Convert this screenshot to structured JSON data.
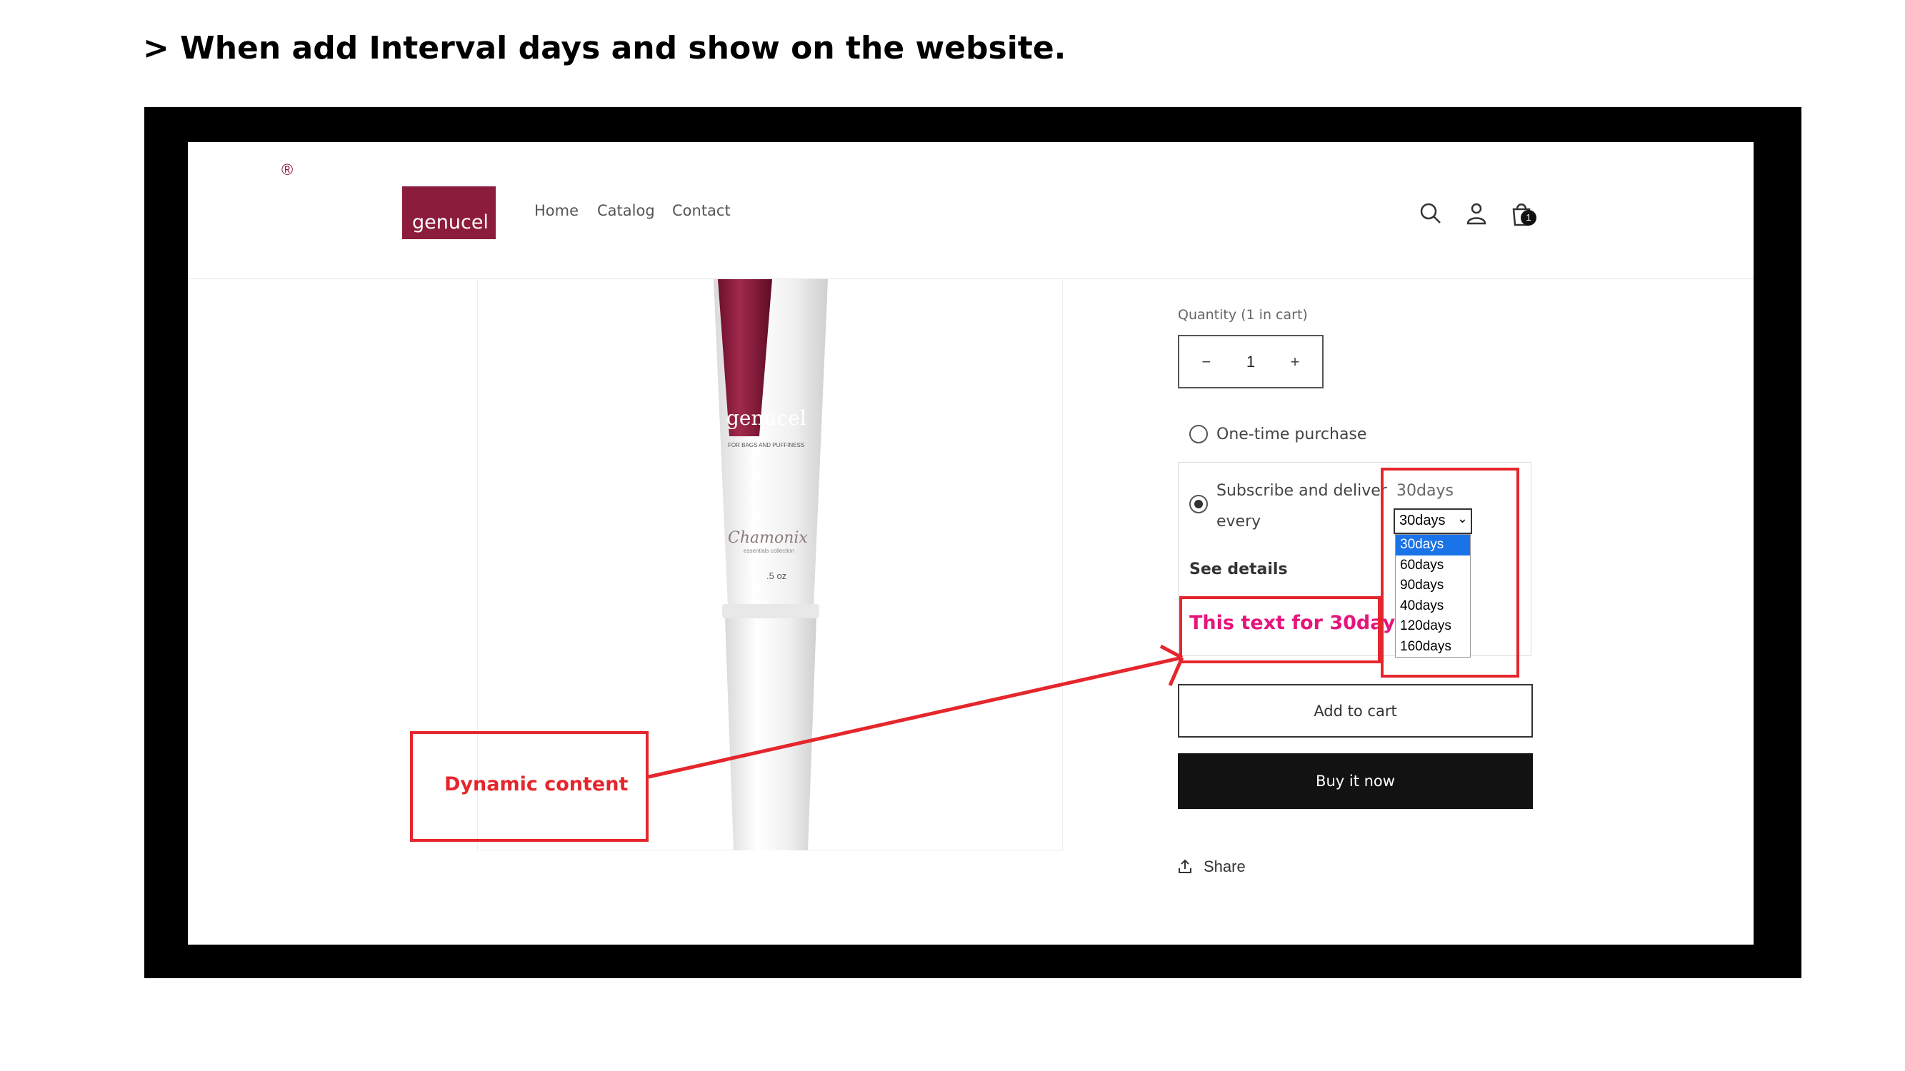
{
  "slide_title": "> When add Interval days and show on the website.",
  "header": {
    "logo_text": "genucel",
    "nav": [
      "Home",
      "Catalog",
      "Contact"
    ],
    "cart_count": "1"
  },
  "product_image": {
    "brand": "genucel",
    "line": "FOR BAGS AND PUFFINESS",
    "collection": "Chamonix",
    "collection_sub": "essentials collection",
    "size": ".5 oz"
  },
  "form": {
    "quantity_label": "Quantity (1 in cart)",
    "quantity_value": "1",
    "minus": "−",
    "plus": "+",
    "one_time_label": "One-time purchase",
    "subscribe_line1": "Subscribe and deliver",
    "subscribe_line2": "every",
    "see_details": "See details",
    "dynamic_text": "This text for 30days",
    "interval_label": "30days",
    "select_value": "30days",
    "interval_options": [
      "30days",
      "60days",
      "90days",
      "40days",
      "120days",
      "160days"
    ],
    "selected_option": "30days",
    "add_to_cart": "Add to cart",
    "buy_now": "Buy it now",
    "share": "Share"
  },
  "annotation": {
    "label": "Dynamic content",
    "color": "#e5262c"
  },
  "colors": {
    "brand": "#8c1c3b",
    "dynamic_text": "#e6157b",
    "option_highlight": "#1a73e8"
  }
}
